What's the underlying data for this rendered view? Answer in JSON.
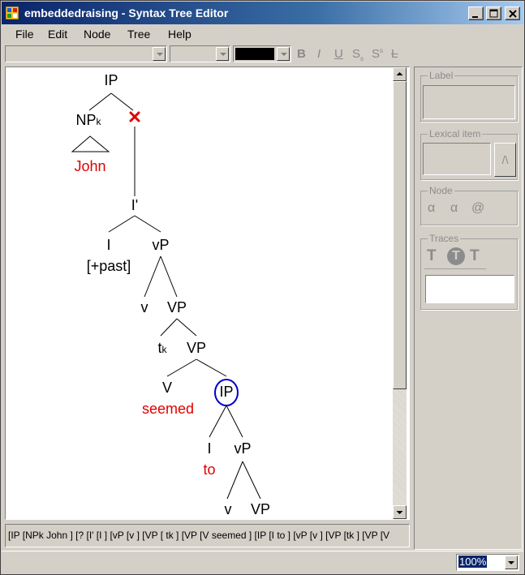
{
  "window": {
    "title": "embeddedraising - Syntax Tree Editor",
    "controls": {
      "minimize": "minimize",
      "maximize": "maximize",
      "close": "close"
    }
  },
  "menu": [
    "File",
    "Edit",
    "Node",
    "Tree",
    "Help"
  ],
  "toolbar": {
    "font_combo_value": "",
    "size_combo_value": "",
    "color": "#000000",
    "format_buttons": [
      "B",
      "I",
      "U",
      "S",
      "S",
      "L"
    ]
  },
  "tree": {
    "nodes": [
      {
        "id": "ip_root",
        "label": "IP"
      },
      {
        "id": "npk",
        "label": "NP",
        "sub": "k"
      },
      {
        "id": "john",
        "label": "John",
        "lexical": true
      },
      {
        "id": "ibar",
        "label": "I'"
      },
      {
        "id": "i1",
        "label": "I"
      },
      {
        "id": "past",
        "label": "[+past]"
      },
      {
        "id": "vp_small1",
        "label": "vP"
      },
      {
        "id": "v1",
        "label": "v"
      },
      {
        "id": "VP1",
        "label": "VP"
      },
      {
        "id": "tk",
        "label": "t",
        "sub": "k"
      },
      {
        "id": "VP2",
        "label": "VP"
      },
      {
        "id": "V",
        "label": "V"
      },
      {
        "id": "seemed",
        "label": "seemed",
        "lexical": true
      },
      {
        "id": "ip_sel",
        "label": "IP",
        "selected": true
      },
      {
        "id": "i2",
        "label": "I"
      },
      {
        "id": "to",
        "label": "to",
        "lexical": true
      },
      {
        "id": "vp_small2",
        "label": "vP"
      },
      {
        "id": "v2",
        "label": "v"
      },
      {
        "id": "VP3",
        "label": "VP"
      }
    ],
    "empty_node_marker": "x"
  },
  "panel": {
    "label_group": {
      "title": "Label",
      "value": ""
    },
    "lexical_group": {
      "title": "Lexical item",
      "value": "",
      "button": "/\\"
    },
    "node_group": {
      "title": "Node",
      "buttons": [
        "α",
        "α",
        "@"
      ]
    },
    "traces_group": {
      "title": "Traces",
      "buttons": [
        "T",
        "T",
        "T"
      ],
      "value": ""
    }
  },
  "bracket_string": "[IP [NPk John ] [? [I' [I ] [vP [v ] [VP [ tk ] [VP [V seemed ] [IP [I to ] [vP [v ] [VP [tk ] [VP [V",
  "status": {
    "zoom": "100%"
  }
}
